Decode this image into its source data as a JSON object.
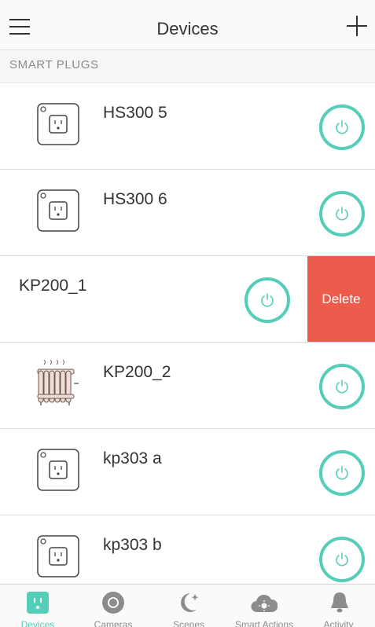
{
  "header": {
    "title": "Devices"
  },
  "section": {
    "label": "SMART PLUGS"
  },
  "devices": [
    {
      "name": "HS300 5",
      "icon": "plug-outlet-icon"
    },
    {
      "name": "HS300 6",
      "icon": "plug-outlet-icon"
    },
    {
      "name": "KP200_1",
      "icon": "",
      "swiped": true,
      "action": "Delete"
    },
    {
      "name": "KP200_2",
      "icon": "heater-radiator-icon"
    },
    {
      "name": "kp303 a",
      "icon": "plug-outlet-icon"
    },
    {
      "name": "kp303 b",
      "icon": "plug-outlet-icon"
    }
  ],
  "tabs": [
    {
      "label": "Devices",
      "icon": "plug-icon",
      "active": true
    },
    {
      "label": "Cameras",
      "icon": "camera-icon",
      "active": false
    },
    {
      "label": "Scenes",
      "icon": "moon-star-icon",
      "active": false
    },
    {
      "label": "Smart Actions",
      "icon": "cloud-sun-icon",
      "active": false
    },
    {
      "label": "Activity",
      "icon": "bell-icon",
      "active": false
    }
  ],
  "colors": {
    "accent": "#54cdb9",
    "delete": "#ec5b4b",
    "heater": "#f0ddd6"
  }
}
